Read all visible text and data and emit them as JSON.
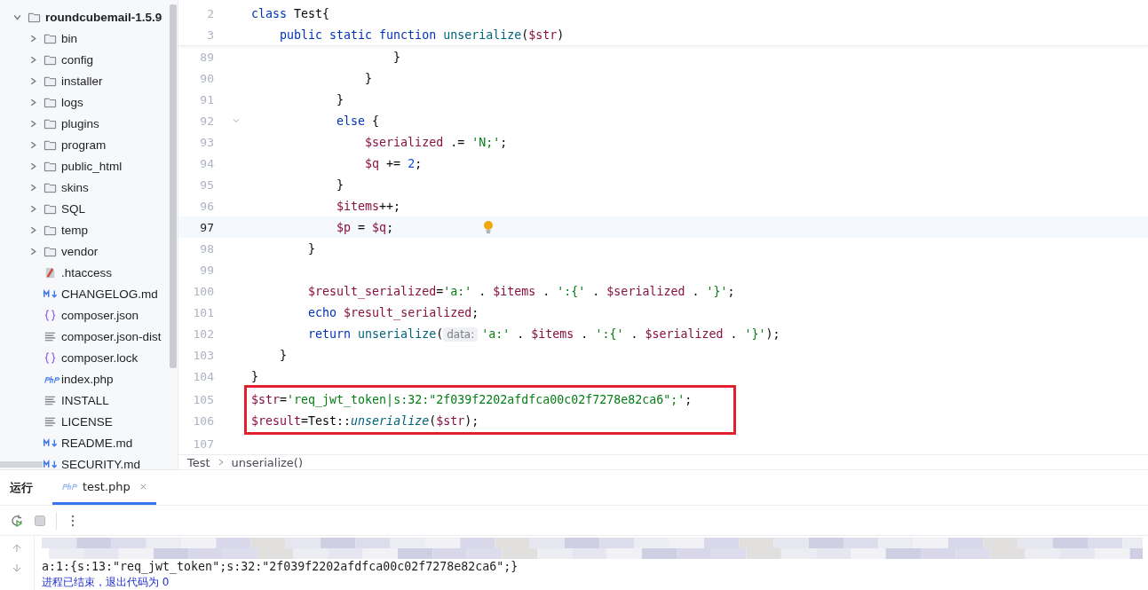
{
  "project_tree": {
    "root": {
      "label": "roundcubemail-1.5.9",
      "kind": "folder",
      "expanded": true,
      "children": [
        {
          "label": "bin",
          "kind": "folder",
          "expanded": false
        },
        {
          "label": "config",
          "kind": "folder",
          "expanded": false
        },
        {
          "label": "installer",
          "kind": "folder",
          "expanded": false
        },
        {
          "label": "logs",
          "kind": "folder",
          "expanded": false
        },
        {
          "label": "plugins",
          "kind": "folder",
          "expanded": false
        },
        {
          "label": "program",
          "kind": "folder",
          "expanded": false
        },
        {
          "label": "public_html",
          "kind": "folder",
          "expanded": false
        },
        {
          "label": "skins",
          "kind": "folder",
          "expanded": false
        },
        {
          "label": "SQL",
          "kind": "folder",
          "expanded": false
        },
        {
          "label": "temp",
          "kind": "folder",
          "expanded": false
        },
        {
          "label": "vendor",
          "kind": "folder",
          "expanded": false
        },
        {
          "label": ".htaccess",
          "kind": "config"
        },
        {
          "label": "CHANGELOG.md",
          "kind": "markdown"
        },
        {
          "label": "composer.json",
          "kind": "json"
        },
        {
          "label": "composer.json-dist",
          "kind": "text"
        },
        {
          "label": "composer.lock",
          "kind": "json"
        },
        {
          "label": "index.php",
          "kind": "php"
        },
        {
          "label": "INSTALL",
          "kind": "text"
        },
        {
          "label": "LICENSE",
          "kind": "text"
        },
        {
          "label": "README.md",
          "kind": "markdown"
        },
        {
          "label": "SECURITY.md",
          "kind": "markdown"
        }
      ]
    }
  },
  "editor": {
    "sticky_lines": [
      {
        "number": "2",
        "tokens": [
          {
            "text": "class ",
            "kind": "keyword"
          },
          {
            "text": "Test{",
            "kind": "plain"
          }
        ]
      },
      {
        "number": "3",
        "tokens": [
          {
            "text": "    public static function ",
            "kind": "keyword"
          },
          {
            "text": "unserialize",
            "kind": "function"
          },
          {
            "text": "(",
            "kind": "plain"
          },
          {
            "text": "$str",
            "kind": "variable"
          },
          {
            "text": ")",
            "kind": "plain"
          }
        ]
      }
    ],
    "lines": [
      {
        "number": "89",
        "current": false,
        "foldable": false,
        "bulb": false,
        "boxed": false,
        "tokens": [
          {
            "text": "                    }",
            "kind": "plain"
          }
        ]
      },
      {
        "number": "90",
        "current": false,
        "foldable": false,
        "bulb": false,
        "boxed": false,
        "tokens": [
          {
            "text": "                }",
            "kind": "plain"
          }
        ]
      },
      {
        "number": "91",
        "current": false,
        "foldable": false,
        "bulb": false,
        "boxed": false,
        "tokens": [
          {
            "text": "            }",
            "kind": "plain"
          }
        ]
      },
      {
        "number": "92",
        "current": false,
        "foldable": true,
        "bulb": false,
        "boxed": false,
        "tokens": [
          {
            "text": "            else",
            "kind": "keyword"
          },
          {
            "text": " {",
            "kind": "plain"
          }
        ]
      },
      {
        "number": "93",
        "current": false,
        "foldable": false,
        "bulb": false,
        "boxed": false,
        "tokens": [
          {
            "text": "                $serialized",
            "kind": "variable"
          },
          {
            "text": " .= ",
            "kind": "plain"
          },
          {
            "text": "'N;'",
            "kind": "string"
          },
          {
            "text": ";",
            "kind": "plain"
          }
        ]
      },
      {
        "number": "94",
        "current": false,
        "foldable": false,
        "bulb": false,
        "boxed": false,
        "tokens": [
          {
            "text": "                $q",
            "kind": "variable"
          },
          {
            "text": " += ",
            "kind": "plain"
          },
          {
            "text": "2",
            "kind": "number"
          },
          {
            "text": ";",
            "kind": "plain"
          }
        ]
      },
      {
        "number": "95",
        "current": false,
        "foldable": false,
        "bulb": false,
        "boxed": false,
        "tokens": [
          {
            "text": "            }",
            "kind": "plain"
          }
        ]
      },
      {
        "number": "96",
        "current": false,
        "foldable": false,
        "bulb": false,
        "boxed": false,
        "tokens": [
          {
            "text": "            $items",
            "kind": "variable"
          },
          {
            "text": "++;",
            "kind": "plain"
          }
        ]
      },
      {
        "number": "97",
        "current": true,
        "foldable": false,
        "bulb": true,
        "boxed": false,
        "tokens": [
          {
            "text": "            $p",
            "kind": "variable"
          },
          {
            "text": " = ",
            "kind": "plain"
          },
          {
            "text": "$q",
            "kind": "variable"
          },
          {
            "text": ";",
            "kind": "plain"
          }
        ]
      },
      {
        "number": "98",
        "current": false,
        "foldable": false,
        "bulb": false,
        "boxed": false,
        "tokens": [
          {
            "text": "        }",
            "kind": "plain"
          }
        ]
      },
      {
        "number": "99",
        "current": false,
        "foldable": false,
        "bulb": false,
        "boxed": false
      },
      {
        "number": "100",
        "current": false,
        "foldable": false,
        "bulb": false,
        "boxed": false,
        "tokens": [
          {
            "text": "        $result_serialized",
            "kind": "variable"
          },
          {
            "text": "=",
            "kind": "plain"
          },
          {
            "text": "'a:'",
            "kind": "string"
          },
          {
            "text": " . ",
            "kind": "plain"
          },
          {
            "text": "$items",
            "kind": "variable"
          },
          {
            "text": " . ",
            "kind": "plain"
          },
          {
            "text": "':{'",
            "kind": "string"
          },
          {
            "text": " . ",
            "kind": "plain"
          },
          {
            "text": "$serialized",
            "kind": "variable"
          },
          {
            "text": " . ",
            "kind": "plain"
          },
          {
            "text": "'}'",
            "kind": "string"
          },
          {
            "text": ";",
            "kind": "plain"
          }
        ]
      },
      {
        "number": "101",
        "current": false,
        "foldable": false,
        "bulb": false,
        "boxed": false,
        "tokens": [
          {
            "text": "        echo",
            "kind": "keyword"
          },
          {
            "text": " $result_serialized",
            "kind": "variable"
          },
          {
            "text": ";",
            "kind": "plain"
          }
        ]
      },
      {
        "number": "102",
        "current": false,
        "foldable": false,
        "bulb": false,
        "boxed": false,
        "tokens": [
          {
            "text": "        return",
            "kind": "keyword"
          },
          {
            "text": " unserialize",
            "kind": "function"
          },
          {
            "text": "(",
            "kind": "plain"
          },
          {
            "text": "data:",
            "kind": "hint"
          },
          {
            "text": "'a:'",
            "kind": "string"
          },
          {
            "text": " . ",
            "kind": "plain"
          },
          {
            "text": "$items",
            "kind": "variable"
          },
          {
            "text": " . ",
            "kind": "plain"
          },
          {
            "text": "':{'",
            "kind": "string"
          },
          {
            "text": " . ",
            "kind": "plain"
          },
          {
            "text": "$serialized",
            "kind": "variable"
          },
          {
            "text": " . ",
            "kind": "plain"
          },
          {
            "text": "'}'",
            "kind": "string"
          },
          {
            "text": ");",
            "kind": "plain"
          }
        ]
      },
      {
        "number": "103",
        "current": false,
        "foldable": false,
        "bulb": false,
        "boxed": false,
        "tokens": [
          {
            "text": "    }",
            "kind": "plain"
          }
        ]
      },
      {
        "number": "104",
        "current": false,
        "foldable": false,
        "bulb": false,
        "boxed": false,
        "tokens": [
          {
            "text": "}",
            "kind": "plain"
          }
        ]
      },
      {
        "number": "105",
        "current": false,
        "foldable": false,
        "bulb": false,
        "boxed": true,
        "tokens": [
          {
            "text": "$str",
            "kind": "variable"
          },
          {
            "text": "=",
            "kind": "plain"
          },
          {
            "text": "'req_jwt_token|s:32:\"2f039f2202afdfca00c02f7278e82ca6\";'",
            "kind": "string"
          },
          {
            "text": ";",
            "kind": "plain"
          }
        ]
      },
      {
        "number": "106",
        "current": false,
        "foldable": false,
        "bulb": false,
        "boxed": true,
        "tokens": [
          {
            "text": "$result",
            "kind": "variable"
          },
          {
            "text": "=Test::",
            "kind": "plain"
          },
          {
            "text": "unserialize",
            "kind": "function_italic"
          },
          {
            "text": "(",
            "kind": "plain"
          },
          {
            "text": "$str",
            "kind": "variable"
          },
          {
            "text": ");",
            "kind": "plain"
          }
        ]
      },
      {
        "number": "107",
        "current": false,
        "foldable": false,
        "bulb": false,
        "boxed": false
      }
    ],
    "breadcrumb": [
      "Test",
      "unserialize()"
    ]
  },
  "run_panel": {
    "title": "运行",
    "tabs": [
      {
        "label": "test.php",
        "selected": true
      }
    ],
    "output": [
      {
        "kind": "redacted"
      },
      {
        "kind": "text",
        "text": "a:1:{s:13:\"req_jwt_token\";s:32:\"2f039f2202afdfca00c02f7278e82ca6\";}"
      },
      {
        "kind": "status",
        "text": "进程已结束，退出代码为 0"
      }
    ]
  }
}
